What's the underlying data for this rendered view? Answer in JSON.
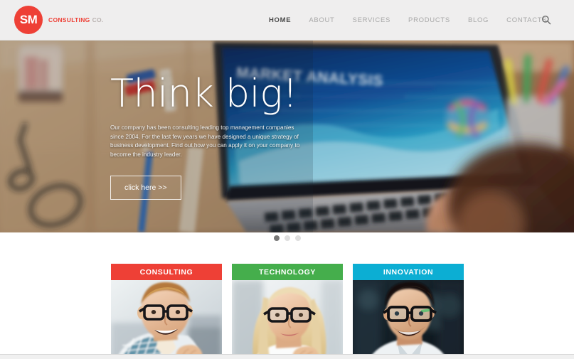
{
  "brand": {
    "badge_text": "SM",
    "name_primary": "CONSULTING",
    "name_secondary": "CO.",
    "accent_color": "#ee4036"
  },
  "nav": {
    "items": [
      {
        "label": "HOME",
        "active": true
      },
      {
        "label": "ABOUT",
        "active": false
      },
      {
        "label": "SERVICES",
        "active": false
      },
      {
        "label": "PRODUCTS",
        "active": false
      },
      {
        "label": "BLOG",
        "active": false
      },
      {
        "label": "CONTACTS",
        "active": false
      }
    ],
    "search_icon": "search-icon"
  },
  "hero": {
    "title": "Think big!",
    "description": "Our company has been consulting leading top management companies since 2004. For the last few years we have designed a unique strategy of business development. Find out how you can apply it on your company to become the industry leader.",
    "cta_label": "click here >>",
    "image_alt": "desk with laptop showing MARKET ANALYSIS chart, hands typing, glasses, pens",
    "laptop_screen_label": "MARKET ANALYSIS"
  },
  "carousel": {
    "slide_count": 3,
    "active_index": 0,
    "active_color": "#777777",
    "inactive_color": "#dedede"
  },
  "cards": [
    {
      "title": "CONSULTING",
      "color": "#ee4036",
      "image_alt": "smiling young man with black glasses in plaid shirt"
    },
    {
      "title": "TECHNOLOGY",
      "color": "#45ae4c",
      "image_alt": "smiling blonde woman with black glasses"
    },
    {
      "title": "INNOVATION",
      "color": "#0caed3",
      "image_alt": "smiling dark-haired man with black glasses in white shirt"
    }
  ]
}
